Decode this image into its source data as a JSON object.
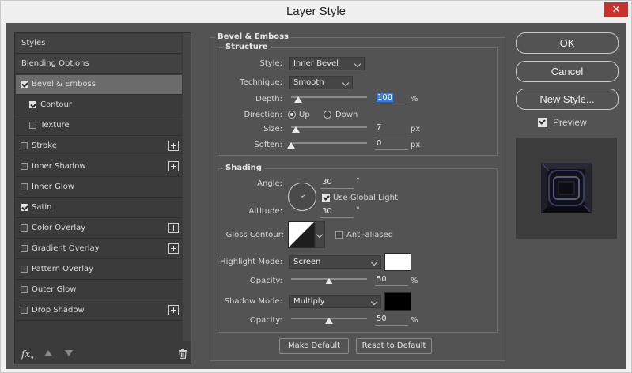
{
  "window": {
    "title": "Layer Style",
    "close_glyph": "✕"
  },
  "left_panel": {
    "items": [
      {
        "label": "Styles",
        "has_checkbox": false
      },
      {
        "label": "Blending Options",
        "has_checkbox": false
      },
      {
        "label": "Bevel & Emboss",
        "has_checkbox": true,
        "checked": true,
        "selected": true
      },
      {
        "label": "Contour",
        "has_checkbox": true,
        "checked": true,
        "sub": true
      },
      {
        "label": "Texture",
        "has_checkbox": true,
        "checked": false,
        "sub": true
      },
      {
        "label": "Stroke",
        "has_checkbox": true,
        "checked": false,
        "has_plus": true
      },
      {
        "label": "Inner Shadow",
        "has_checkbox": true,
        "checked": false,
        "has_plus": true
      },
      {
        "label": "Inner Glow",
        "has_checkbox": true,
        "checked": false
      },
      {
        "label": "Satin",
        "has_checkbox": true,
        "checked": true
      },
      {
        "label": "Color Overlay",
        "has_checkbox": true,
        "checked": false,
        "has_plus": true
      },
      {
        "label": "Gradient Overlay",
        "has_checkbox": true,
        "checked": false,
        "has_plus": true
      },
      {
        "label": "Pattern Overlay",
        "has_checkbox": true,
        "checked": false
      },
      {
        "label": "Outer Glow",
        "has_checkbox": true,
        "checked": false
      },
      {
        "label": "Drop Shadow",
        "has_checkbox": true,
        "checked": false,
        "has_plus": true
      }
    ],
    "toolbar": {
      "fx_label": "fx",
      "fx_caret": "▾"
    }
  },
  "bevel": {
    "group_title": "Bevel & Emboss",
    "structure": {
      "title": "Structure",
      "style_label": "Style:",
      "style_value": "Inner Bevel",
      "technique_label": "Technique:",
      "technique_value": "Smooth",
      "depth_label": "Depth:",
      "depth_value": "100",
      "depth_unit": "%",
      "direction_label": "Direction:",
      "dir_up": "Up",
      "dir_down": "Down",
      "direction_selected": "Up",
      "size_label": "Size:",
      "size_value": "7",
      "size_unit": "px",
      "soften_label": "Soften:",
      "soften_value": "0",
      "soften_unit": "px"
    },
    "shading": {
      "title": "Shading",
      "angle_label": "Angle:",
      "angle_value": "30",
      "degree": "°",
      "global_light_label": "Use Global Light",
      "global_light_checked": true,
      "altitude_label": "Altitude:",
      "altitude_value": "30",
      "gloss_label": "Gloss Contour:",
      "antialias_label": "Anti-aliased",
      "antialias_checked": false,
      "highlight_label": "Highlight Mode:",
      "highlight_value": "Screen",
      "highlight_color": "#ffffff",
      "hl_opacity_label": "Opacity:",
      "hl_opacity_value": "50",
      "hl_opacity_unit": "%",
      "shadow_label": "Shadow Mode:",
      "shadow_value": "Multiply",
      "shadow_color": "#000000",
      "sh_opacity_label": "Opacity:",
      "sh_opacity_value": "50",
      "sh_opacity_unit": "%"
    },
    "make_default": "Make Default",
    "reset_default": "Reset to Default"
  },
  "sliders": {
    "depth": 0.09,
    "size": 0.06,
    "soften": 0.0,
    "hl_opacity": 0.5,
    "sh_opacity": 0.5
  },
  "actions": {
    "ok": "OK",
    "cancel": "Cancel",
    "new_style": "New Style...",
    "preview_label": "Preview",
    "preview_checked": true
  }
}
